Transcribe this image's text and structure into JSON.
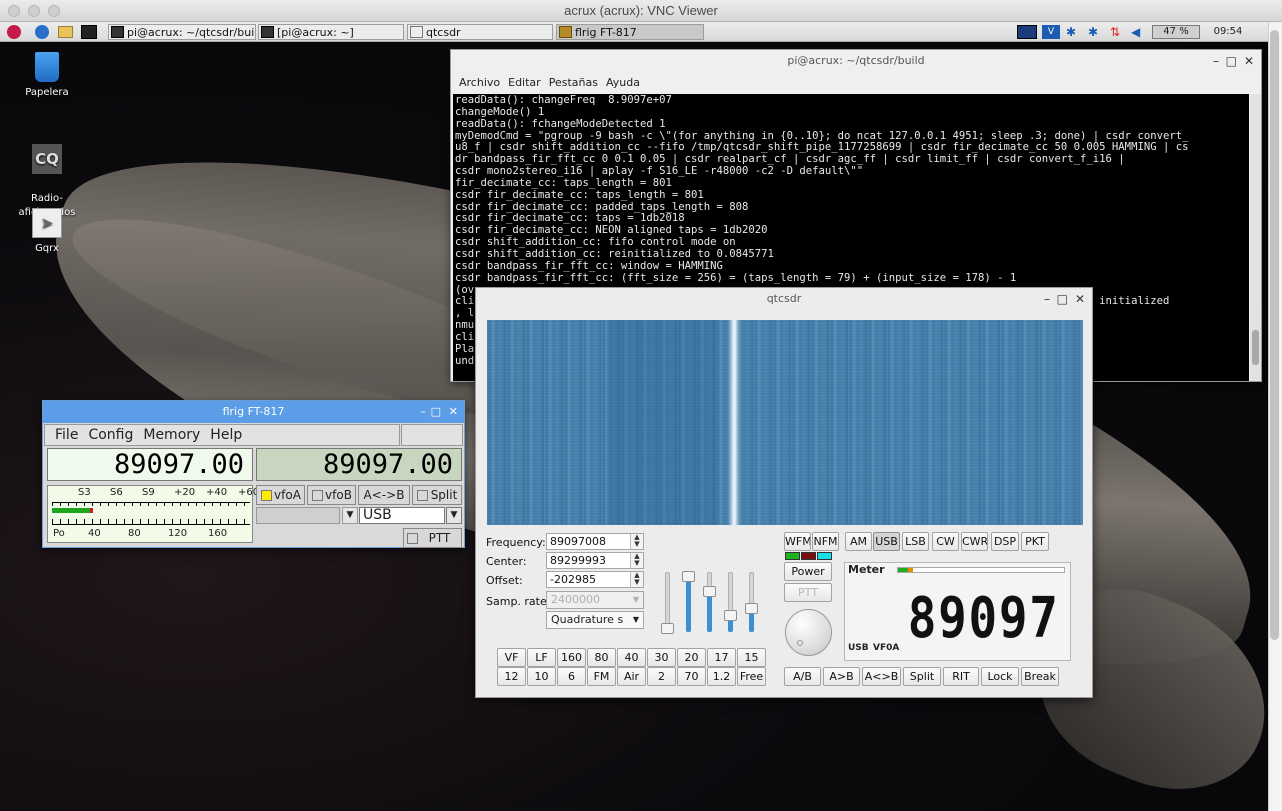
{
  "vnc": {
    "title": "acrux (acrux): VNC Viewer"
  },
  "taskbar": {
    "windows": [
      {
        "label": "pi@acrux: ~/qtcsdr/build"
      },
      {
        "label": "[pi@acrux: ~]"
      },
      {
        "label": "qtcsdr"
      },
      {
        "label": "flrig FT-817"
      }
    ],
    "cpu": "47 %",
    "clock": "09:54"
  },
  "desktop": {
    "icons": [
      {
        "label": "Papelera"
      },
      {
        "label": "Radio-\naficionados"
      },
      {
        "label": "Gqrx"
      }
    ]
  },
  "terminal": {
    "title": "pi@acrux: ~/qtcsdr/build",
    "menu": [
      "Archivo",
      "Editar",
      "Pestañas",
      "Ayuda"
    ],
    "lines": [
      "readData(): changeFreq  8.9097e+07",
      "changeMode() 1",
      "readData(): fchangeModeDetected 1",
      "myDemodCmd = \"pgroup -9 bash -c \\\"(for anything in {0..10}; do ncat 127.0.0.1 4951; sleep .3; done) | csdr convert_",
      "u8_f | csdr shift_addition_cc --fifo /tmp/qtcsdr_shift_pipe_1177258699 | csdr fir_decimate_cc 50 0.005 HAMMING | cs",
      "dr bandpass_fir_fft_cc 0 0.1 0.05 | csdr realpart_cf | csdr agc_ff | csdr limit_ff | csdr convert_f_i16 |",
      "csdr mono2stereo_i16 | aplay -f S16_LE -r48000 -c2 -D default\\\"\"",
      "fir_decimate_cc: taps_length = 801",
      "csdr fir_decimate_cc: taps_length = 801",
      "csdr fir_decimate_cc: padded_taps_length = 808",
      "csdr fir_decimate_cc: taps = 1db2018",
      "csdr fir_decimate_cc: NEON aligned taps = 1db2020",
      "csdr shift_addition_cc: fifo control mode on",
      "csdr shift_addition_cc: reinitialized to 0.0845771",
      "csdr bandpass_fir_fft_cc: window = HAMMING",
      "csdr bandpass_fir_fft_cc: (fft_size = 256) = (taps_length = 79) + (input_size = 178) - 1",
      "(ov",
      "cli                                                                                       cc: filter initialized",
      ", l",
      "nmu",
      "cli",
      "Pla",
      "und",
      " "
    ]
  },
  "qtcsdr": {
    "title": "qtcsdr",
    "frequency_label": "Frequency:",
    "frequency": "89097008",
    "center_label": "Center:",
    "center": "89299993",
    "offset_label": "Offset:",
    "offset": "-202985",
    "samp_rate_label": "Samp. rate:",
    "samp_rate": "2400000",
    "sampling": "Quadrature s",
    "modes": [
      "WFM",
      "NFM",
      "AM",
      "USB",
      "LSB",
      "CW",
      "CWR",
      "DSP",
      "PKT"
    ],
    "active_mode": "USB",
    "power_label": "Power",
    "ptt_label": "PTT",
    "bands_row1": [
      "VF",
      "LF",
      "160",
      "80",
      "40",
      "30",
      "20",
      "17",
      "15"
    ],
    "bands_row2": [
      "12",
      "10",
      "6",
      "FM",
      "Air",
      "2",
      "70",
      "1.2",
      "Free"
    ],
    "vfo_buttons": [
      "A/B",
      "A>B",
      "A<>B",
      "Split",
      "RIT",
      "Lock",
      "Break"
    ],
    "sliders": [
      0.08,
      0.95,
      0.7,
      0.3,
      0.42
    ],
    "meter": {
      "label": "Meter",
      "digits": "89097",
      "mode": "USB",
      "vfo": "VF0A"
    }
  },
  "flrig": {
    "title": "flrig FT-817",
    "menu": [
      "File",
      "Config",
      "Memory",
      "Help"
    ],
    "freq_a": "89097.00",
    "freq_b": "89097.00",
    "s_scale": [
      "S3",
      "S6",
      "S9",
      "+20",
      "+40",
      "+60"
    ],
    "po_scale": [
      "Po",
      "40",
      "80",
      "120",
      "160"
    ],
    "buttons": {
      "vfoa": "vfoA",
      "vfob": "vfoB",
      "swap": "A<->B",
      "split": "Split",
      "ptt": "PTT"
    },
    "mode": "USB",
    "colors": {
      "freq_a_bg": "#f0faec",
      "freq_b_bg": "#c8d6c0",
      "title_bg": "#5b9de6"
    }
  }
}
